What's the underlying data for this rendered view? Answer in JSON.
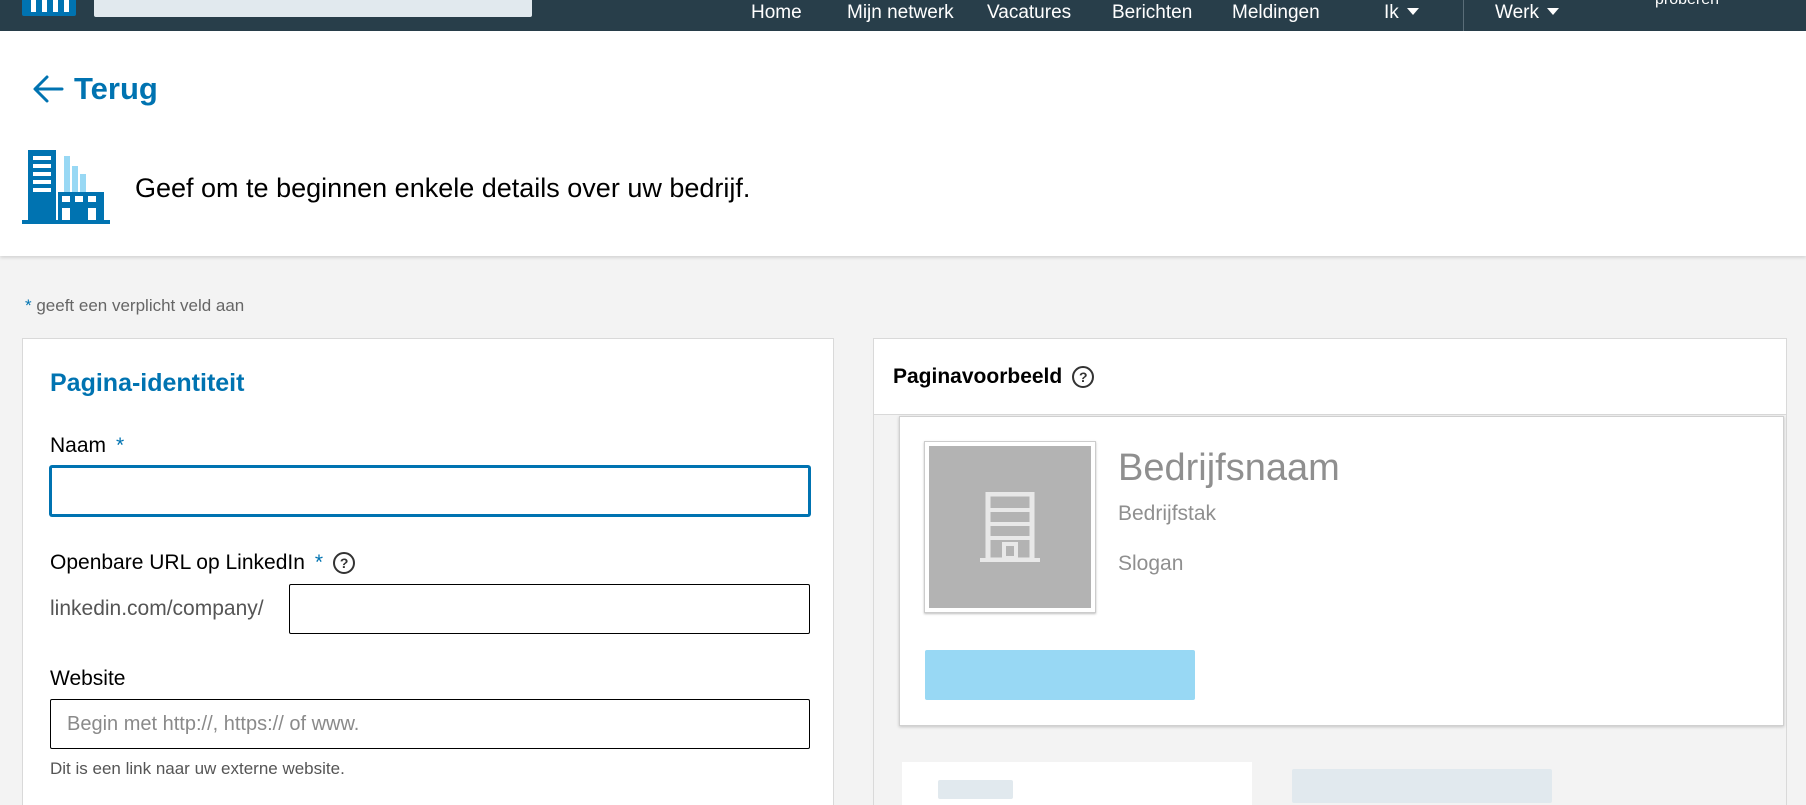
{
  "nav": {
    "items": [
      {
        "label": "Home"
      },
      {
        "label": "Mijn netwerk"
      },
      {
        "label": "Vacatures"
      },
      {
        "label": "Berichten"
      },
      {
        "label": "Meldingen"
      },
      {
        "label": "Ik"
      },
      {
        "label": "Werk"
      }
    ],
    "try_label": "proberen"
  },
  "header": {
    "back_label": "Terug",
    "intro": "Geef om te beginnen enkele details over uw bedrijf."
  },
  "form": {
    "required_note_star": "*",
    "required_note": " geeft een verplicht veld aan",
    "section_title": "Pagina-identiteit",
    "name_label": "Naam",
    "name_value": "",
    "required_star": "*",
    "url_label": "Openbare URL op LinkedIn",
    "url_prefix": "linkedin.com/company/",
    "url_value": "",
    "website_label": "Website",
    "website_placeholder": "Begin met http://, https:// of www.",
    "website_hint": "Dit is een link naar uw externe website."
  },
  "preview": {
    "title": "Paginavoorbeeld",
    "company_name": "Bedrijfsnaam",
    "industry": "Bedrijfstak",
    "slogan": "Slogan"
  },
  "icons": {
    "help": "?",
    "back": "arrow-left-icon",
    "building": "building-icon"
  },
  "colors": {
    "brand": "#0073b1",
    "nav_bg": "#283e4a",
    "cta_placeholder": "#98d8f4"
  }
}
